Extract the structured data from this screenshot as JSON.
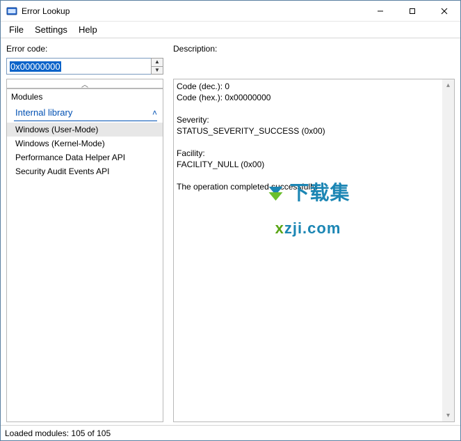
{
  "window": {
    "title": "Error Lookup"
  },
  "menubar": {
    "file": "File",
    "settings": "Settings",
    "help": "Help"
  },
  "errorcode": {
    "label": "Error code:",
    "value": "0x00000000"
  },
  "modules": {
    "title": "Modules",
    "section": "Internal library",
    "items": [
      "Windows (User-Mode)",
      "Windows (Kernel-Mode)",
      "Performance Data Helper API",
      "Security Audit Events API"
    ]
  },
  "description": {
    "label": "Description:",
    "code_dec_label": "Code (dec.): ",
    "code_dec_value": "0",
    "code_hex_label": "Code (hex.): ",
    "code_hex_value": "0x00000000",
    "severity_label": "Severity:",
    "severity_value": "STATUS_SEVERITY_SUCCESS (0x00)",
    "facility_label": "Facility:",
    "facility_value": "FACILITY_NULL (0x00)",
    "message": "The operation completed successfully."
  },
  "status": {
    "text": "Loaded modules: 105 of 105"
  },
  "watermark": {
    "cn": "下载集",
    "url_x": "x",
    "url_rest": "zji.com"
  }
}
